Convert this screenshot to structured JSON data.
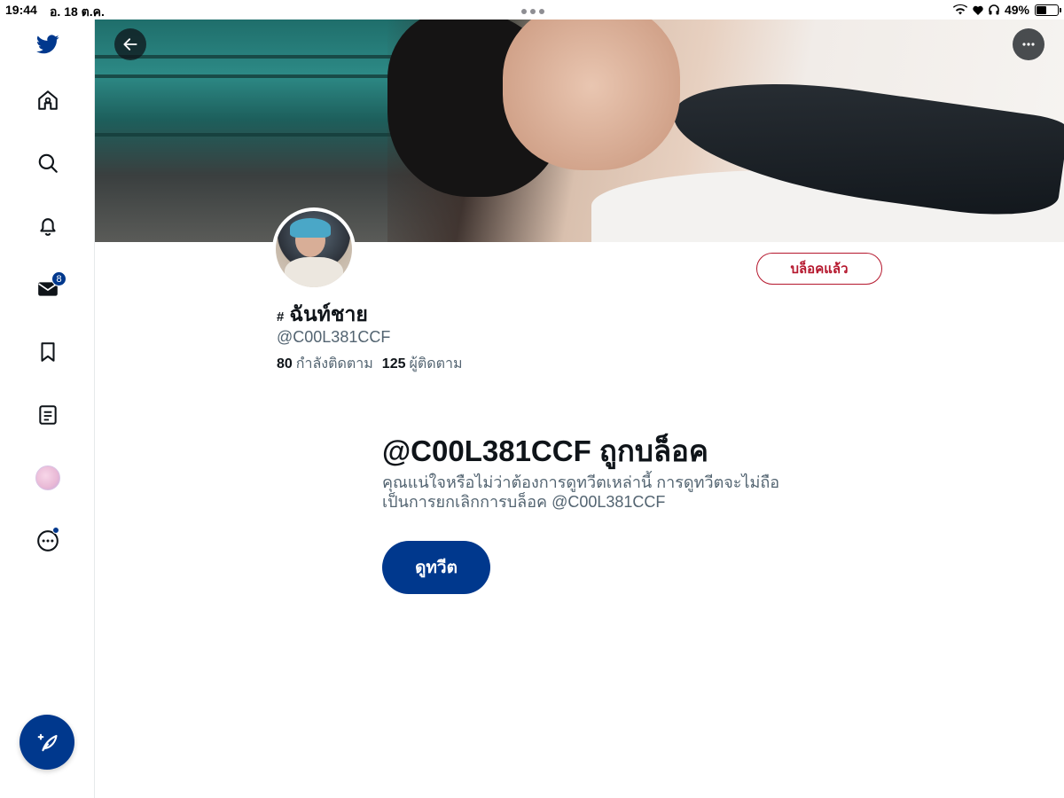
{
  "status_bar": {
    "time": "19:44",
    "date": "อ. 18 ต.ค.",
    "battery": "49%",
    "battery_level": 0.49
  },
  "sidebar": {
    "items": [
      {
        "icon": "twitter-bird-icon"
      },
      {
        "icon": "home-icon"
      },
      {
        "icon": "search-icon"
      },
      {
        "icon": "bell-icon"
      },
      {
        "icon": "mail-icon",
        "badge": "8"
      },
      {
        "icon": "bookmark-icon"
      },
      {
        "icon": "lists-icon"
      },
      {
        "icon": "account-avatar"
      },
      {
        "icon": "more-icon"
      }
    ],
    "compose_icon": "compose-icon"
  },
  "profile": {
    "display_name": "ฉันท์ชาย",
    "name_prefix": "#",
    "handle": "@C00L381CCF",
    "following_count": "80",
    "following_label": "กำลังติดตาม",
    "followers_count": "125",
    "followers_label": "ผู้ติดตาม",
    "blocked_button": "บล็อคแล้ว"
  },
  "blocked_notice": {
    "title": "@C00L381CCF ถูกบล็อค",
    "description": "คุณแน่ใจหรือไม่ว่าต้องการดูทวีตเหล่านี้ การดูทวีตจะไม่ถือเป็นการยกเลิกการบล็อค @C00L381CCF",
    "view_button": "ดูทวีต"
  },
  "colors": {
    "accent": "#00388d",
    "danger": "#b5172d",
    "secondary_text": "#536471"
  }
}
